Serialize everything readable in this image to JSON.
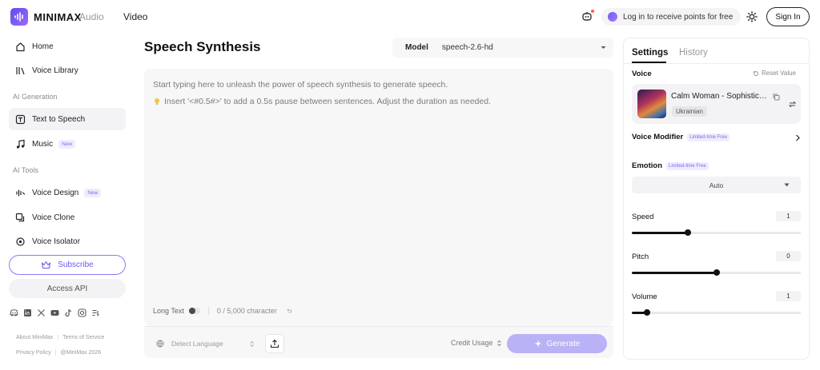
{
  "brand": {
    "name": "MINIMAX"
  },
  "topnav": {
    "audio": "Audio",
    "video": "Video"
  },
  "header": {
    "login_text": "Log in to receive points for free",
    "signin_label": "Sign In"
  },
  "sidebar": {
    "items": [
      {
        "label": "Home",
        "icon": "home-icon"
      },
      {
        "label": "Voice Library",
        "icon": "library-icon"
      }
    ],
    "sections": [
      {
        "title": "AI Generation",
        "items": [
          {
            "label": "Text to Speech",
            "icon": "tts-icon",
            "active": true
          },
          {
            "label": "Music",
            "icon": "music-icon",
            "badge": "New"
          }
        ]
      },
      {
        "title": "AI Tools",
        "items": [
          {
            "label": "Voice Design",
            "icon": "voice-design-icon",
            "badge": "New"
          },
          {
            "label": "Voice Clone",
            "icon": "voice-clone-icon"
          },
          {
            "label": "Voice Isolator",
            "icon": "voice-isolator-icon"
          }
        ]
      }
    ],
    "subscribe_label": "Subscribe",
    "access_api_label": "Access API",
    "socials": [
      "discord-icon",
      "linkedin-icon",
      "x-icon",
      "youtube-icon",
      "tiktok-icon",
      "instagram-icon",
      "rednote-icon"
    ],
    "footer": {
      "about": "About MiniMax",
      "terms": "Terms of Service",
      "privacy": "Privacy Policy",
      "copyright": "@MiniMax 2026"
    }
  },
  "editor": {
    "title": "Speech Synthesis",
    "model_label": "Model",
    "model_value": "speech-2.6-hd",
    "placeholder": "Start typing here to unleash the power of speech synthesis to generate speech.",
    "tip": "Insert '<#0.5#>' to add a 0.5s pause between sentences. Adjust the duration as needed.",
    "long_text_label": "Long Text",
    "long_text_on": false,
    "char_count": "0 / 5,000 character",
    "detect_language": "Detect Language",
    "credit_usage": "Credit Usage",
    "generate_label": "Generate"
  },
  "panel": {
    "tabs": {
      "settings": "Settings",
      "history": "History"
    },
    "voice_label": "Voice",
    "reset_label": "Reset Value",
    "voice": {
      "name": "Calm Woman - Sophisticated",
      "language": "Ukrainian"
    },
    "voice_modifier_label": "Voice Modifier",
    "limited_badge": "Limited-time Free",
    "emotion_label": "Emotion",
    "emotion_value": "Auto",
    "speed": {
      "label": "Speed",
      "value": "1",
      "fraction": 0.33
    },
    "pitch": {
      "label": "Pitch",
      "value": "0",
      "fraction": 0.5
    },
    "volume": {
      "label": "Volume",
      "value": "1",
      "fraction": 0.09
    }
  },
  "colors": {
    "accent": "#7c6bf2",
    "generate_bg": "#b9b2f6"
  }
}
